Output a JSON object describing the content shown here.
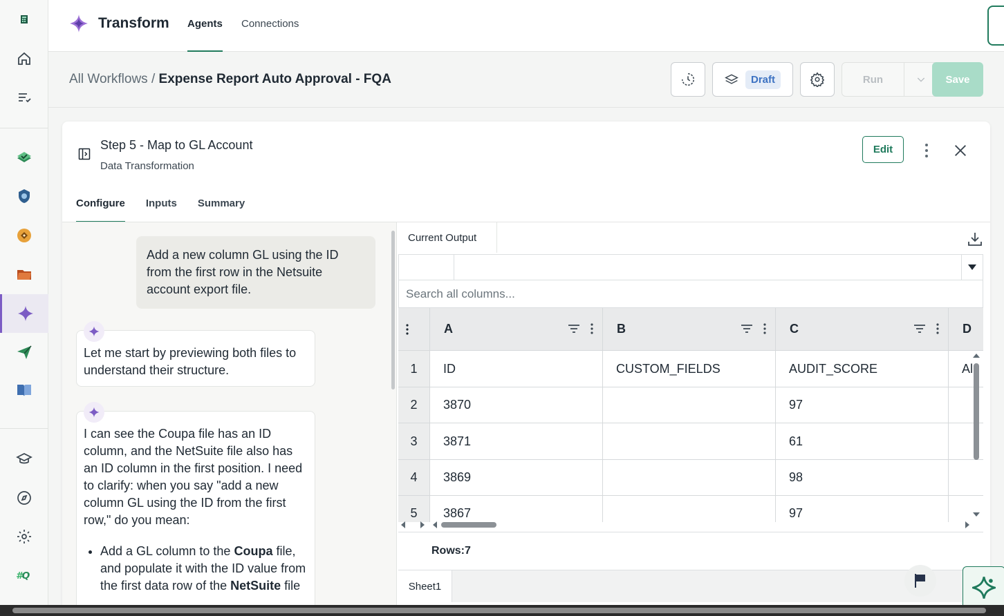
{
  "topbar": {
    "brand": "Transform",
    "tabs": [
      {
        "label": "Agents",
        "active": true
      },
      {
        "label": "Connections",
        "active": false
      }
    ]
  },
  "breadcrumb": {
    "parent": "All Workflows",
    "separator": "/",
    "current": "Expense Report Auto Approval - FQA"
  },
  "toolbar": {
    "draft_label": "Draft",
    "run_label": "Run",
    "save_label": "Save"
  },
  "step": {
    "title": "Step 5 - Map to GL Account",
    "subtitle": "Data Transformation",
    "edit_label": "Edit",
    "tabs": [
      {
        "label": "Configure",
        "active": true
      },
      {
        "label": "Inputs",
        "active": false
      },
      {
        "label": "Summary",
        "active": false
      }
    ]
  },
  "chat": {
    "user_message": "Add a new column GL using the ID from the first row in the Netsuite account export file.",
    "bot_message_1": "Let me start by previewing both files to understand their structure.",
    "bot_message_2": "I can see the Coupa file has an ID column, and the NetSuite file also has an ID column in the first position. I need to clarify: when you say \"add a new column GL using the ID from the first row,\" do you mean:",
    "bullet_1_parts": [
      "Add a GL column to the ",
      "Coupa",
      " file, and populate it with the ID value from the first data row of the ",
      "NetSuite",
      " file"
    ]
  },
  "sheet": {
    "output_tab": "Current Output",
    "search_placeholder": "Search all columns...",
    "columns": [
      "A",
      "B",
      "C",
      "D"
    ],
    "rows": [
      {
        "n": "1",
        "a": "ID",
        "b": "CUSTOM_FIELDS",
        "c": "AUDIT_SCORE",
        "d": "Al"
      },
      {
        "n": "2",
        "a": "3870",
        "b": "",
        "c": "97",
        "d": ""
      },
      {
        "n": "3",
        "a": "3871",
        "b": "",
        "c": "61",
        "d": ""
      },
      {
        "n": "4",
        "a": "3869",
        "b": "",
        "c": "98",
        "d": ""
      },
      {
        "n": "5",
        "a": "3867",
        "b": "",
        "c": "97",
        "d": ""
      }
    ],
    "rows_label": "Rows:7",
    "sheet_tab": "Sheet1"
  },
  "colors": {
    "accent_green": "#1f7a5c",
    "brand_purple": "#7c5cc4",
    "draft_blue": "#3c72c2",
    "save_disabled": "#a9dcc8"
  },
  "icons": [
    "grid-app-icon",
    "home-icon",
    "tasks-icon",
    "check-layers-icon",
    "shield-icon",
    "sync-icon",
    "folder-icon",
    "sparkle-icon",
    "send-icon",
    "book-icon",
    "graduation-icon",
    "compass-icon",
    "gear-icon",
    "fq-logo-icon"
  ]
}
